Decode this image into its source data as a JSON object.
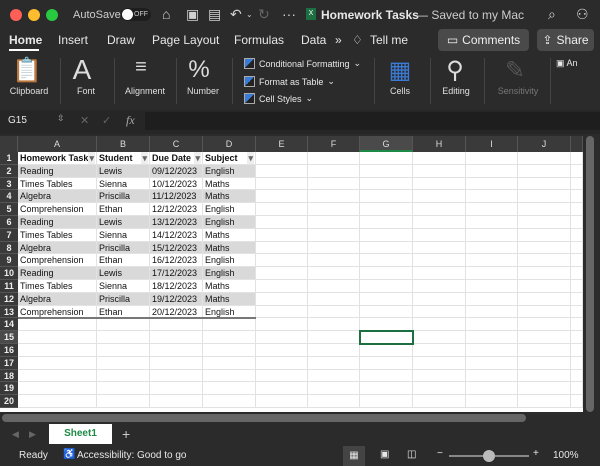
{
  "titlebar": {
    "autosave": "AutoSave",
    "toggle": "OFF",
    "title": "Homework Tasks",
    "saved": "— Saved to my Mac"
  },
  "tabs": [
    "Home",
    "Insert",
    "Draw",
    "Page Layout",
    "Formulas",
    "Data"
  ],
  "tell_me": "Tell me",
  "comments": "Comments",
  "share": "Share",
  "ribbon": {
    "clipboard": "Clipboard",
    "font": "Font",
    "alignment": "Alignment",
    "number": "Number",
    "conditional": "Conditional Formatting",
    "format_table": "Format as Table",
    "cell_styles": "Cell Styles",
    "cells": "Cells",
    "editing": "Editing",
    "sensitivity": "Sensitivity",
    "addins": "An"
  },
  "formula_bar": {
    "name_box": "G15",
    "formula": ""
  },
  "columns": [
    "A",
    "B",
    "C",
    "D",
    "E",
    "F",
    "G",
    "H",
    "I",
    "J"
  ],
  "header_row": [
    "Homework Task",
    "Student",
    "Due Date",
    "Subject"
  ],
  "rows": [
    [
      "Reading",
      "Lewis",
      "09/12/2023",
      "English"
    ],
    [
      "Times Tables",
      "Sienna",
      "10/12/2023",
      "Maths"
    ],
    [
      "Algebra",
      "Priscilla",
      "11/12/2023",
      "Maths"
    ],
    [
      "Comprehension",
      "Ethan",
      "12/12/2023",
      "English"
    ],
    [
      "Reading",
      "Lewis",
      "13/12/2023",
      "English"
    ],
    [
      "Times Tables",
      "Sienna",
      "14/12/2023",
      "Maths"
    ],
    [
      "Algebra",
      "Priscilla",
      "15/12/2023",
      "Maths"
    ],
    [
      "Comprehension",
      "Ethan",
      "16/12/2023",
      "English"
    ],
    [
      "Reading",
      "Lewis",
      "17/12/2023",
      "English"
    ],
    [
      "Times Tables",
      "Sienna",
      "18/12/2023",
      "Maths"
    ],
    [
      "Algebra",
      "Priscilla",
      "19/12/2023",
      "Maths"
    ],
    [
      "Comprehension",
      "Ethan",
      "20/12/2023",
      "English"
    ]
  ],
  "row_numbers": [
    "1",
    "2",
    "3",
    "4",
    "5",
    "6",
    "7",
    "8",
    "9",
    "10",
    "11",
    "12",
    "13",
    "14",
    "15",
    "16",
    "17",
    "18",
    "19",
    "20"
  ],
  "selected_cell": "G15",
  "sheet_tab": "Sheet1",
  "status": {
    "ready": "Ready",
    "accessibility": "Accessibility: Good to go",
    "zoom": "100%",
    "zoom_fraction": 0.5
  }
}
